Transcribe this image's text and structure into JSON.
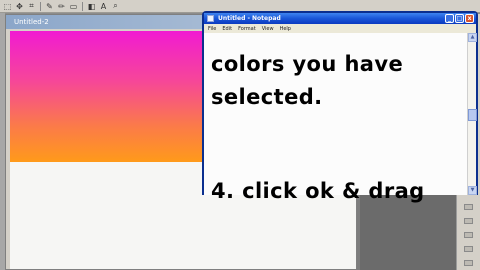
{
  "editor": {
    "document_title": "Untitled-2"
  },
  "toolbar": {
    "icons": [
      "select-icon",
      "move-icon",
      "crop-icon",
      "brush-icon",
      "pencil-icon",
      "eraser-icon",
      "fill-icon",
      "text-icon",
      "zoom-icon"
    ]
  },
  "notepad": {
    "title": "Untitled - Notepad",
    "menu": [
      "File",
      "Edit",
      "Format",
      "View",
      "Help"
    ],
    "lines": [
      "colors you have",
      "selected.",
      "",
      "4. click ok & drag"
    ],
    "controls": {
      "minimize": "_",
      "maximize": "□",
      "close": "x"
    }
  },
  "colors": {
    "gradient_top": "#f11bd2",
    "gradient_bottom": "#ff9a1a",
    "titlebar_blue": "#1a56d8"
  }
}
